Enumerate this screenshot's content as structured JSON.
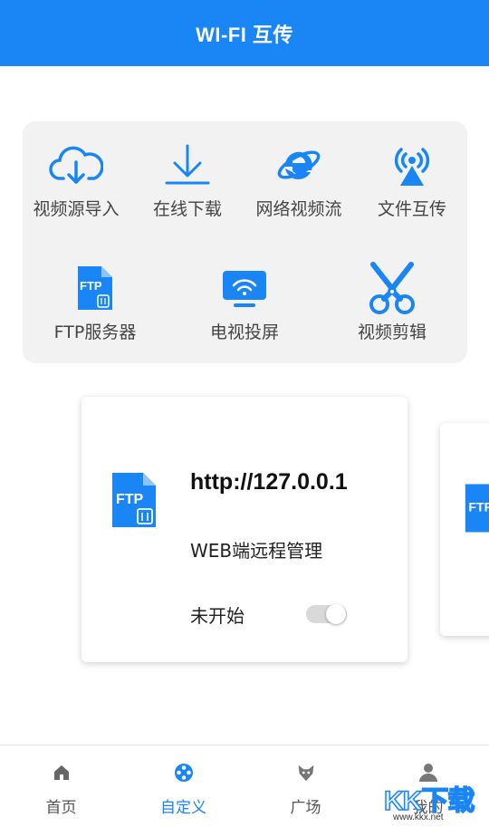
{
  "header": {
    "title": "WI-FI 互传"
  },
  "tools": [
    {
      "label": "视频源导入",
      "icon": "cloud-download-icon"
    },
    {
      "label": "在线下载",
      "icon": "download-arrow-icon"
    },
    {
      "label": "网络视频流",
      "icon": "ie-browser-icon"
    },
    {
      "label": "文件互传",
      "icon": "broadcast-tower-icon"
    },
    {
      "label": "FTP服务器",
      "icon": "ftp-file-icon"
    },
    {
      "label": "电视投屏",
      "icon": "tv-cast-icon"
    },
    {
      "label": "视频剪辑",
      "icon": "scissors-icon"
    }
  ],
  "ftp_icon_text": "FTP",
  "card": {
    "url": "http://127.0.0.1",
    "description": "WEB端远程管理",
    "status": "未开始",
    "toggle_on": false
  },
  "tabs": [
    {
      "label": "首页",
      "icon": "home-icon",
      "active": false
    },
    {
      "label": "自定义",
      "icon": "film-reel-icon",
      "active": true
    },
    {
      "label": "广场",
      "icon": "fox-icon",
      "active": false
    },
    {
      "label": "我的",
      "icon": "user-icon",
      "active": false
    }
  ],
  "watermark": {
    "text": "KK下载",
    "url": "www.kkx.net"
  },
  "colors": {
    "primary": "#1a86f5",
    "panel": "#f2f2f2"
  }
}
